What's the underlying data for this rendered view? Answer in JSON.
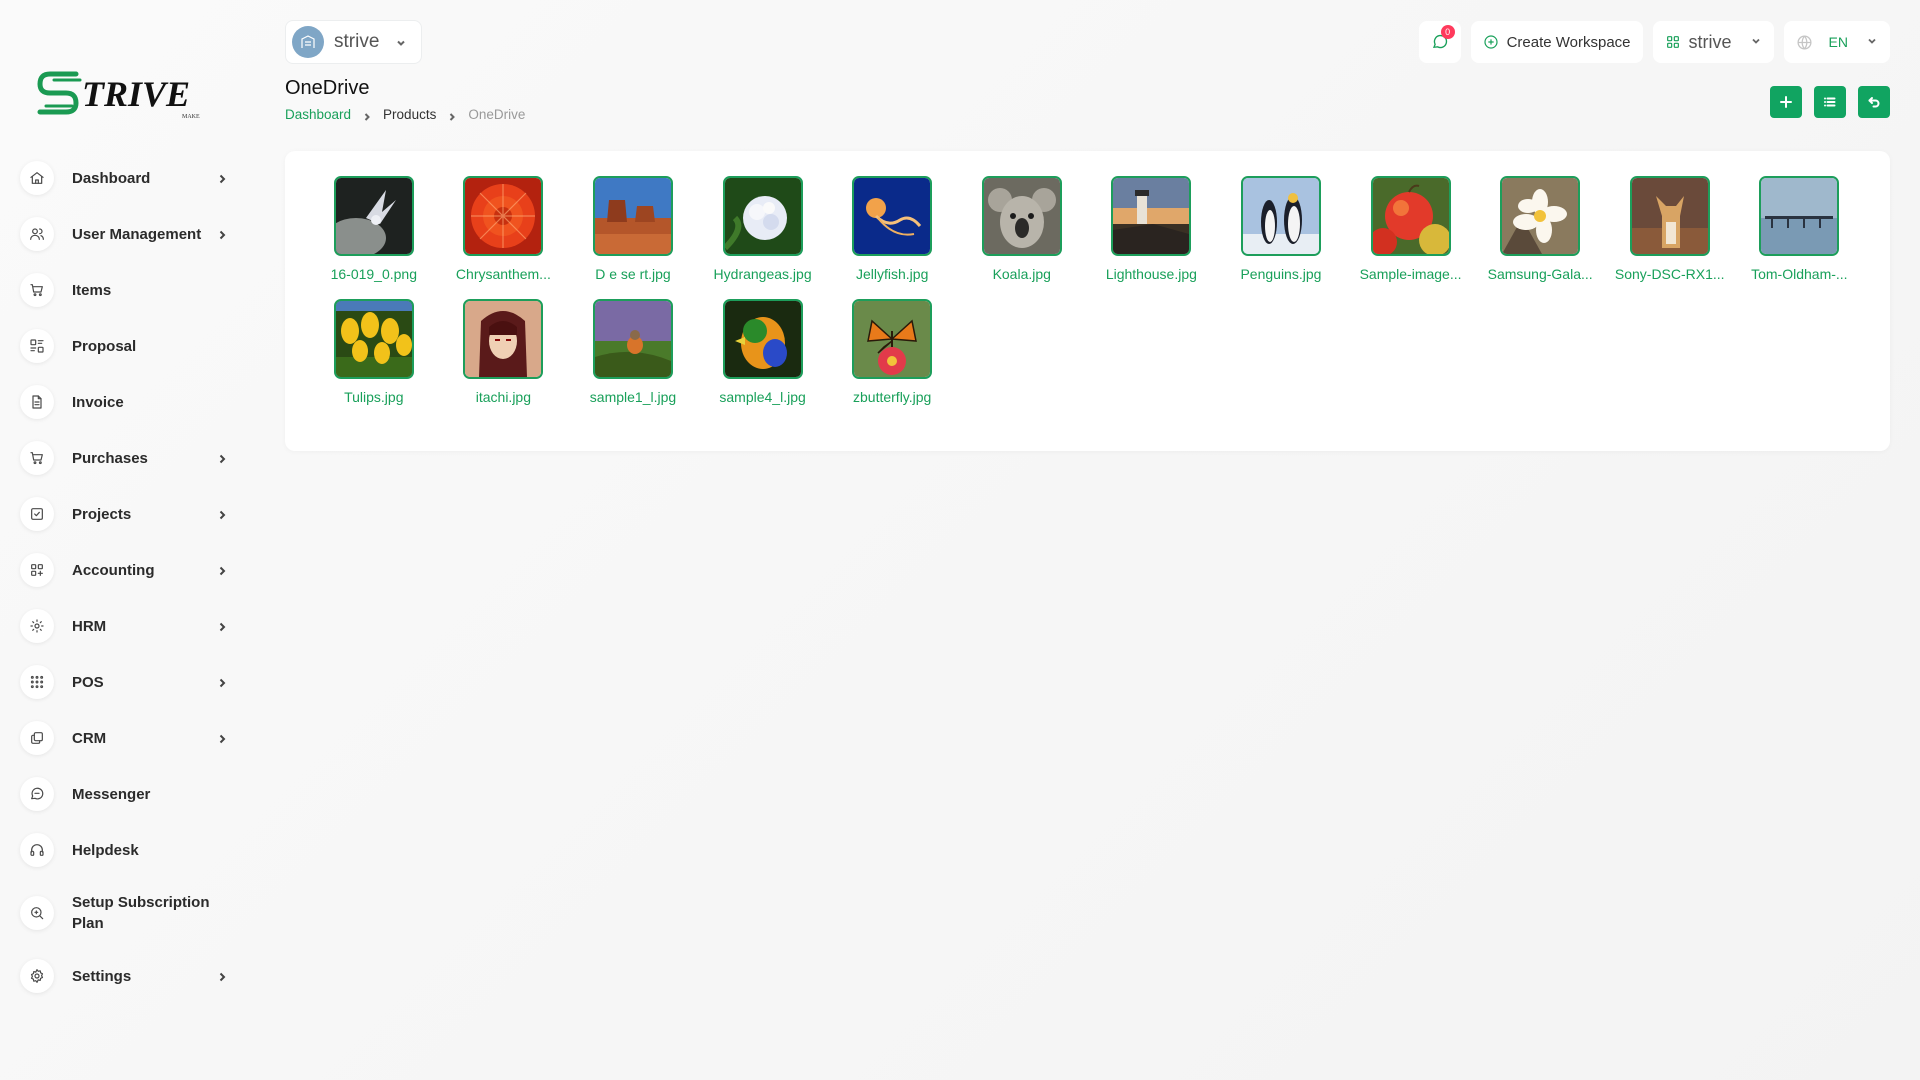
{
  "logo": {
    "text": "TRIVE",
    "sub": "MAKE"
  },
  "sidebar": {
    "items": [
      {
        "label": "Dashboard",
        "icon": "home-icon",
        "chevron": true
      },
      {
        "label": "User Management",
        "icon": "users-icon",
        "chevron": true
      },
      {
        "label": "Items",
        "icon": "cart-icon",
        "chevron": false
      },
      {
        "label": "Proposal",
        "icon": "proposal-icon",
        "chevron": false
      },
      {
        "label": "Invoice",
        "icon": "file-icon",
        "chevron": false
      },
      {
        "label": "Purchases",
        "icon": "cart-icon",
        "chevron": true
      },
      {
        "label": "Projects",
        "icon": "checkbox-icon",
        "chevron": true
      },
      {
        "label": "Accounting",
        "icon": "grid-icon",
        "chevron": true
      },
      {
        "label": "HRM",
        "icon": "hrm-icon",
        "chevron": true
      },
      {
        "label": "POS",
        "icon": "dots-grid-icon",
        "chevron": true
      },
      {
        "label": "CRM",
        "icon": "crm-icon",
        "chevron": true
      },
      {
        "label": "Messenger",
        "icon": "chat-icon",
        "chevron": false
      },
      {
        "label": "Helpdesk",
        "icon": "headset-icon",
        "chevron": false
      },
      {
        "label": "Setup Subscription Plan",
        "icon": "zoom-icon",
        "chevron": false
      },
      {
        "label": "Settings",
        "icon": "gear-icon",
        "chevron": true
      }
    ]
  },
  "header": {
    "workspace_name": "strive",
    "messages_count": "0",
    "create_workspace_label": "Create Workspace",
    "workspace_switcher_label": "strive",
    "language": "EN"
  },
  "page": {
    "title": "OneDrive",
    "breadcrumb": [
      "Dashboard",
      "Products",
      "OneDrive"
    ]
  },
  "files": [
    {
      "name": "16-019_0.png",
      "thumb": "bird"
    },
    {
      "name": "Chrysanthem...",
      "thumb": "chrysanthemum"
    },
    {
      "name": "D e se rt.jpg",
      "thumb": "desert"
    },
    {
      "name": "Hydrangeas.jpg",
      "thumb": "hydrangeas"
    },
    {
      "name": "Jellyfish.jpg",
      "thumb": "jellyfish"
    },
    {
      "name": "Koala.jpg",
      "thumb": "koala"
    },
    {
      "name": "Lighthouse.jpg",
      "thumb": "lighthouse"
    },
    {
      "name": "Penguins.jpg",
      "thumb": "penguins"
    },
    {
      "name": "Sample-image...",
      "thumb": "apples"
    },
    {
      "name": "Samsung-Gala...",
      "thumb": "flower"
    },
    {
      "name": "Sony-DSC-RX1...",
      "thumb": "dog"
    },
    {
      "name": "Tom-Oldham-...",
      "thumb": "pier"
    },
    {
      "name": "Tulips.jpg",
      "thumb": "tulips"
    },
    {
      "name": "itachi.jpg",
      "thumb": "anime"
    },
    {
      "name": "sample1_l.jpg",
      "thumb": "robin"
    },
    {
      "name": "sample4_l.jpg",
      "thumb": "parrot"
    },
    {
      "name": "zbutterfly.jpg",
      "thumb": "butterfly"
    }
  ],
  "colors": {
    "accent": "#11a461",
    "badge": "#ff3a5c"
  }
}
